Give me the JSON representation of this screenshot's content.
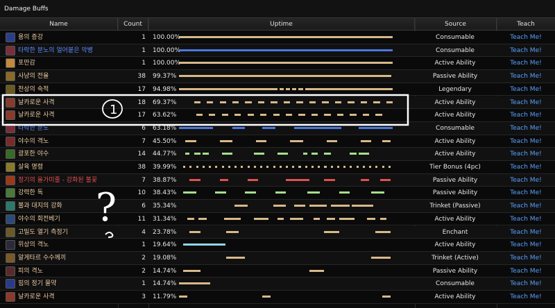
{
  "panel": {
    "title": "Damage Buffs"
  },
  "columns": {
    "name": "Name",
    "count": "Count",
    "uptime": "Uptime",
    "source": "Source",
    "teach": "Teach"
  },
  "colors": {
    "tan": "#d8b98a",
    "blue": "#4a78e0",
    "green": "#a6e08a",
    "red": "#e05050",
    "cyan": "#8fd7e8",
    "name_default": "#e8c9a0",
    "name_blue": "#5a8cff",
    "name_red": "#e05050",
    "teach": "#5aa0ff"
  },
  "rows": [
    {
      "name": "용의 증강",
      "count": "1",
      "uptime": "100.00%",
      "source": "Consumable",
      "teach": "Teach Me!",
      "name_color": "#e8c9a0",
      "bar_color": "#d8b98a",
      "icon_color": "#2a3f8a",
      "segs": [
        [
          0,
          100
        ]
      ]
    },
    {
      "name": "타락한 분노의 얼어붙은 악병",
      "count": "1",
      "uptime": "100.00%",
      "source": "Consumable",
      "teach": "Teach Me!",
      "name_color": "#5a8cff",
      "bar_color": "#4a78e0",
      "icon_color": "#7a2e3a",
      "segs": [
        [
          0,
          100
        ]
      ]
    },
    {
      "name": "포만감",
      "count": "1",
      "uptime": "100.00%",
      "source": "Active Ability",
      "teach": "Teach Me!",
      "name_color": "#e8c9a0",
      "bar_color": "#d8b98a",
      "icon_color": "#c28a3a",
      "segs": [
        [
          0,
          100
        ]
      ]
    },
    {
      "name": "사냥의 전율",
      "count": "38",
      "uptime": "99.37%",
      "source": "Passive Ability",
      "teach": "Teach Me!",
      "name_color": "#e8c9a0",
      "bar_color": "#d8b98a",
      "icon_color": "#8a6a2a",
      "segs": [
        [
          0,
          99.4
        ]
      ]
    },
    {
      "name": "천상의 숙적",
      "count": "17",
      "uptime": "94.98%",
      "source": "Legendary",
      "teach": "Teach Me!",
      "name_color": "#e8c9a0",
      "bar_color": "#d8b98a",
      "icon_color": "#6a5a20",
      "segs": [
        [
          0,
          46
        ],
        [
          47,
          49
        ],
        [
          50,
          52
        ],
        [
          53,
          55
        ],
        [
          56,
          58
        ],
        [
          59,
          100
        ]
      ]
    },
    {
      "name": "날카로운 사격",
      "count": "18",
      "uptime": "69.37%",
      "source": "Active Ability",
      "teach": "Teach Me!",
      "name_color": "#e8c9a0",
      "bar_color": "#d8b98a",
      "icon_color": "#8a3a2a",
      "segs": [
        [
          7,
          10
        ],
        [
          13,
          16
        ],
        [
          19,
          22
        ],
        [
          25,
          28
        ],
        [
          31,
          34
        ],
        [
          37,
          40
        ],
        [
          43,
          46
        ],
        [
          49,
          52
        ],
        [
          55,
          58
        ],
        [
          61,
          64
        ],
        [
          67,
          70
        ],
        [
          73,
          76
        ],
        [
          79,
          82
        ],
        [
          85,
          88
        ],
        [
          91,
          94
        ],
        [
          97,
          100
        ]
      ]
    },
    {
      "name": "날카로운 사격",
      "count": "17",
      "uptime": "63.62%",
      "source": "Active Ability",
      "teach": "Teach Me!",
      "name_color": "#e8c9a0",
      "bar_color": "#d8b98a",
      "icon_color": "#8a3a2a",
      "segs": [
        [
          8,
          11
        ],
        [
          14,
          17
        ],
        [
          20,
          23
        ],
        [
          26,
          29
        ],
        [
          32,
          35
        ],
        [
          38,
          41
        ],
        [
          44,
          47
        ],
        [
          50,
          53
        ],
        [
          56,
          59
        ],
        [
          62,
          65
        ],
        [
          68,
          71
        ],
        [
          74,
          77
        ],
        [
          80,
          83
        ],
        [
          86,
          89
        ],
        [
          92,
          95
        ]
      ]
    },
    {
      "name": "타락한 분노",
      "count": "6",
      "uptime": "63.18%",
      "source": "Consumable",
      "teach": "Teach Me!",
      "name_color": "#5a8cff",
      "bar_color": "#4a78e0",
      "icon_color": "#7a2e3a",
      "segs": [
        [
          0,
          16
        ],
        [
          25,
          31
        ],
        [
          39,
          45
        ],
        [
          54,
          76
        ],
        [
          84,
          100
        ]
      ]
    },
    {
      "name": "야수의 격노",
      "count": "7",
      "uptime": "45.50%",
      "source": "Active Ability",
      "teach": "Teach Me!",
      "name_color": "#e8c9a0",
      "bar_color": "#d8b98a",
      "icon_color": "#7a2a2a",
      "segs": [
        [
          3,
          8
        ],
        [
          19,
          25
        ],
        [
          36,
          41
        ],
        [
          52,
          58
        ],
        [
          69,
          74
        ],
        [
          85,
          90
        ],
        [
          95,
          99
        ]
      ]
    },
    {
      "name": "광포한 야수",
      "count": "14",
      "uptime": "44.77%",
      "source": "Active Ability",
      "teach": "Teach Me!",
      "name_color": "#e8c9a0",
      "bar_color": "#a6e08a",
      "icon_color": "#3a6a2a",
      "segs": [
        [
          3,
          5
        ],
        [
          7,
          10
        ],
        [
          11,
          14
        ],
        [
          20,
          25
        ],
        [
          35,
          40
        ],
        [
          46,
          51
        ],
        [
          58,
          60
        ],
        [
          62,
          65
        ],
        [
          68,
          71
        ],
        [
          80,
          83
        ],
        [
          84,
          89
        ]
      ]
    },
    {
      "name": "살육 명령",
      "count": "38",
      "uptime": "39.99%",
      "source": "Tier Bonus (4pc)",
      "teach": "Teach Me!",
      "name_color": "#e8c9a0",
      "bar_color": "#d8b98a",
      "icon_color": "#8a7a2a",
      "segs": [
        [
          2,
          3
        ],
        [
          5,
          6
        ],
        [
          8,
          9
        ],
        [
          11,
          12
        ],
        [
          14,
          15
        ],
        [
          17,
          18
        ],
        [
          20,
          21
        ],
        [
          23,
          24
        ],
        [
          26,
          27
        ],
        [
          29,
          30
        ],
        [
          32,
          33
        ],
        [
          35,
          36
        ],
        [
          38,
          39
        ],
        [
          41,
          42
        ],
        [
          44,
          45
        ],
        [
          47,
          48
        ],
        [
          50,
          51
        ],
        [
          53,
          54
        ],
        [
          56,
          57
        ],
        [
          59,
          60
        ],
        [
          62,
          63
        ],
        [
          65,
          66
        ],
        [
          68,
          69
        ],
        [
          71,
          72
        ],
        [
          74,
          75
        ],
        [
          77,
          78
        ],
        [
          80,
          81
        ],
        [
          83,
          84
        ],
        [
          86,
          87
        ],
        [
          89,
          90
        ],
        [
          92,
          93
        ],
        [
          95,
          96
        ],
        [
          98,
          99
        ]
      ]
    },
    {
      "name": "정기의 올가미줄 - 강화된 불꽃",
      "count": "7",
      "uptime": "38.87%",
      "source": "Passive Ability",
      "teach": "Teach Me!",
      "name_color": "#e05050",
      "bar_color": "#e05050",
      "icon_color": "#9a3a1a",
      "segs": [
        [
          5,
          10
        ],
        [
          19,
          23
        ],
        [
          32,
          37
        ],
        [
          50,
          61
        ],
        [
          68,
          73
        ],
        [
          85,
          89
        ],
        [
          94,
          99
        ]
      ]
    },
    {
      "name": "강력한 독",
      "count": "10",
      "uptime": "38.43%",
      "source": "Passive Ability",
      "teach": "Teach Me!",
      "name_color": "#e8c9a0",
      "bar_color": "#a6e08a",
      "icon_color": "#4a7a3a",
      "segs": [
        [
          2,
          8
        ],
        [
          17,
          22
        ],
        [
          31,
          36
        ],
        [
          45,
          50
        ],
        [
          60,
          66
        ],
        [
          75,
          80
        ],
        [
          90,
          96
        ]
      ]
    },
    {
      "name": "불과 대지의 강화",
      "count": "6",
      "uptime": "35.34%",
      "source": "Trinket (Passive)",
      "teach": "Teach Me!",
      "name_color": "#e8c9a0",
      "bar_color": "#d8b98a",
      "icon_color": "#2a7a6a",
      "segs": [
        [
          26,
          32
        ],
        [
          44,
          50
        ],
        [
          54,
          59
        ],
        [
          61,
          69
        ],
        [
          71,
          80
        ],
        [
          81,
          91
        ]
      ]
    },
    {
      "name": "야수의 회전베기",
      "count": "11",
      "uptime": "31.34%",
      "source": "Active Ability",
      "teach": "Teach Me!",
      "name_color": "#e8c9a0",
      "bar_color": "#d8b98a",
      "icon_color": "#2a4a7a",
      "segs": [
        [
          4,
          7
        ],
        [
          9,
          13
        ],
        [
          21,
          29
        ],
        [
          35,
          42
        ],
        [
          46,
          49
        ],
        [
          52,
          58
        ],
        [
          63,
          66
        ],
        [
          69,
          73
        ],
        [
          75,
          82
        ],
        [
          88,
          92
        ],
        [
          94,
          97
        ]
      ]
    },
    {
      "name": "고밀도 열기 측정기",
      "count": "4",
      "uptime": "23.78%",
      "source": "Enchant",
      "teach": "Teach Me!",
      "name_color": "#e8c9a0",
      "bar_color": "#d8b98a",
      "icon_color": "#6a5a2a",
      "segs": [
        [
          5,
          10
        ],
        [
          22,
          28
        ],
        [
          68,
          75
        ],
        [
          92,
          99
        ]
      ]
    },
    {
      "name": "위상의 격노",
      "count": "1",
      "uptime": "19.64%",
      "source": "Active Ability",
      "teach": "Teach Me!",
      "name_color": "#e8c9a0",
      "bar_color": "#8fd7e8",
      "icon_color": "#2a2a3a",
      "segs": [
        [
          2,
          21.6
        ]
      ]
    },
    {
      "name": "알게타르 수수께끼",
      "count": "2",
      "uptime": "19.08%",
      "source": "Trinket (Active)",
      "teach": "Teach Me!",
      "name_color": "#e8c9a0",
      "bar_color": "#d8b98a",
      "icon_color": "#7a5a2a",
      "segs": [
        [
          22,
          31
        ],
        [
          90,
          99
        ]
      ]
    },
    {
      "name": "피의 격노",
      "count": "2",
      "uptime": "14.74%",
      "source": "Passive Ability",
      "teach": "Teach Me!",
      "name_color": "#e8c9a0",
      "bar_color": "#d8b98a",
      "icon_color": "#5a2a2a",
      "segs": [
        [
          2,
          10
        ],
        [
          61,
          68
        ]
      ]
    },
    {
      "name": "힘의 정기 물약",
      "count": "1",
      "uptime": "14.74%",
      "source": "Consumable",
      "teach": "Teach Me!",
      "name_color": "#e8c9a0",
      "bar_color": "#d8b98a",
      "icon_color": "#2a3a8a",
      "segs": [
        [
          0,
          14.7
        ]
      ]
    },
    {
      "name": "날카로운 사격",
      "count": "3",
      "uptime": "11.79%",
      "source": "Active Ability",
      "teach": "Teach Me!",
      "name_color": "#e8c9a0",
      "bar_color": "#d8b98a",
      "icon_color": "#8a3a2a",
      "segs": [
        [
          0,
          4
        ],
        [
          39,
          43
        ],
        [
          95,
          99
        ]
      ]
    }
  ],
  "annotations": {
    "circle_one": "1",
    "question": "?"
  }
}
